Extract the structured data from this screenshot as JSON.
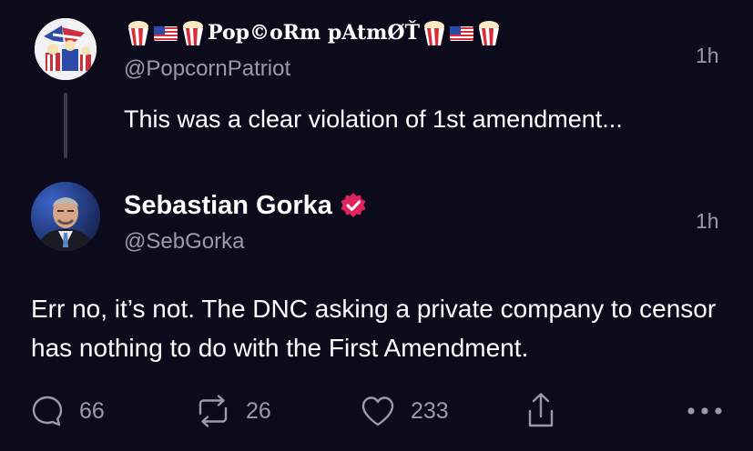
{
  "reply_tweet": {
    "display_name": "Pop©oRm pAtmØŤ",
    "handle": "@PopcornPatriot",
    "time": "1h",
    "text": "This was a clear violation of 1st amendment..."
  },
  "main_tweet": {
    "display_name": "Sebastian Gorka",
    "handle": "@SebGorka",
    "time": "1h",
    "text": "Err no, it’s not. The DNC asking a private company to censor has nothing to do with the First Amendment."
  },
  "actions": {
    "replies": "66",
    "retweets": "26",
    "likes": "233"
  },
  "icons": {
    "popcorn": "popcorn-icon",
    "flag": "us-flag-icon",
    "verified": "verified-badge-icon",
    "reply": "reply-icon",
    "retweet": "retweet-icon",
    "like": "heart-icon",
    "share": "share-icon",
    "more": "more-icon"
  },
  "colors": {
    "background": "#0c0b1c",
    "text": "#ffffff",
    "muted": "#9c9aa8",
    "verified": "#e0245e",
    "thread_line": "#3b3a4a"
  }
}
